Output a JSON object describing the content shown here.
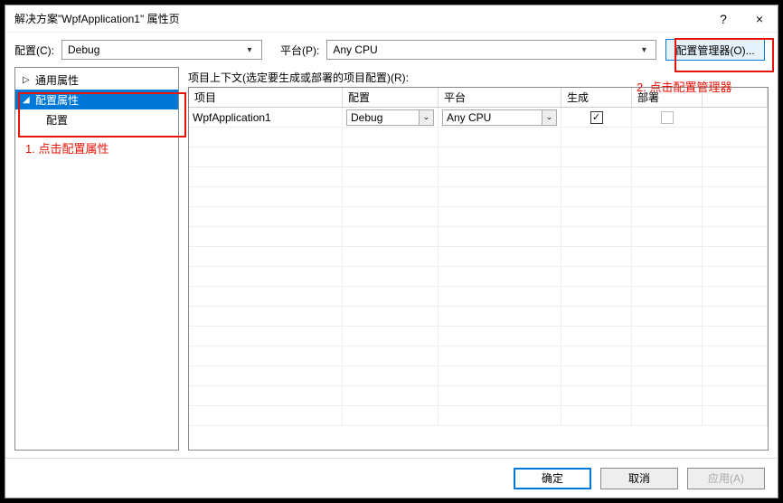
{
  "window": {
    "title": "解决方案\"WpfApplication1\" 属性页",
    "help": "?",
    "close": "×"
  },
  "toolbar": {
    "config_label": "配置(C):",
    "config_value": "Debug",
    "platform_label": "平台(P):",
    "platform_value": "Any CPU",
    "config_manager_label": "配置管理器(O)..."
  },
  "tree": {
    "common": "通用属性",
    "config_props": "配置属性",
    "config": "配置"
  },
  "context_label": "项目上下文(选定要生成或部署的项目配置)(R):",
  "grid": {
    "headers": {
      "project": "项目",
      "config": "配置",
      "platform": "平台",
      "build": "生成",
      "deploy": "部署"
    },
    "row": {
      "project": "WpfApplication1",
      "config": "Debug",
      "platform": "Any CPU",
      "build_checked": "✓",
      "deploy_checked": ""
    }
  },
  "footer": {
    "ok": "确定",
    "cancel": "取消",
    "apply": "应用(A)"
  },
  "annotations": {
    "a1": "1. 点击配置属性",
    "a2": "2. 点击配置管理器"
  }
}
